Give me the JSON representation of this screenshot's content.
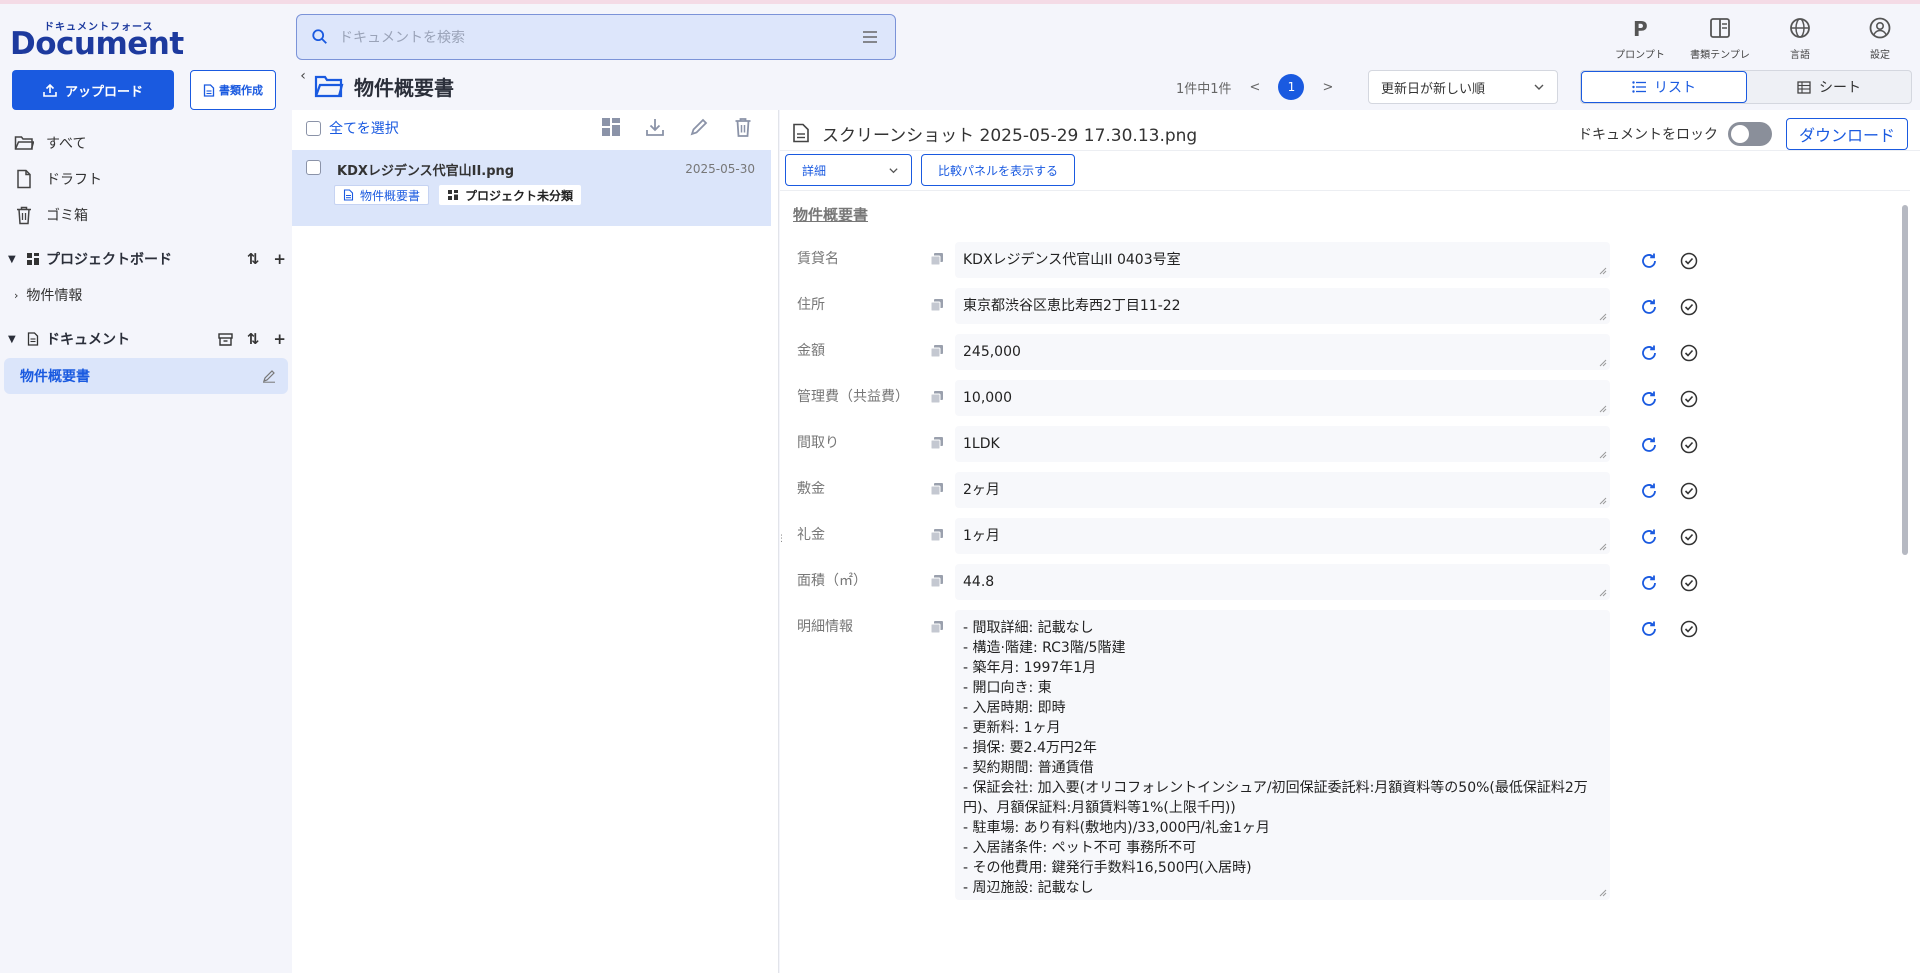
{
  "app": {
    "logo_kana": "ドキュメントフォース",
    "logo_name": "Document Force"
  },
  "search": {
    "placeholder": "ドキュメントを検索"
  },
  "top_icons": [
    {
      "label": "プロンプト",
      "icon": "prompt-p-icon"
    },
    {
      "label": "書類テンプレ",
      "icon": "template-icon"
    },
    {
      "label": "言語",
      "icon": "globe-icon"
    },
    {
      "label": "設定",
      "icon": "user-circle-icon"
    }
  ],
  "sidebar": {
    "upload_label": "アップロード",
    "create_label": "書類作成",
    "nav": [
      {
        "label": "すべて",
        "icon": "folder-open-icon"
      },
      {
        "label": "ドラフト",
        "icon": "file-icon"
      },
      {
        "label": "ゴミ箱",
        "icon": "trash-icon"
      }
    ],
    "project_board": {
      "label": "プロジェクトボード",
      "items": [
        "物件情報"
      ]
    },
    "documents": {
      "label": "ドキュメント",
      "active_item": "物件概要書"
    }
  },
  "list": {
    "folder_title": "物件概要書",
    "pager_text": "1件中1件",
    "current_page": "1",
    "sort_label": "更新日が新しい順",
    "view_list": "リスト",
    "view_sheet": "シート",
    "select_all": "全てを選択",
    "items": [
      {
        "filename": "KDXレジデンス代官山II.png",
        "date": "2025-05-30",
        "tag_type": "物件概要書",
        "tag_project": "プロジェクト未分類"
      }
    ]
  },
  "detail": {
    "filename": "スクリーンショット 2025-05-29 17.30.13.png",
    "lock_label": "ドキュメントをロック",
    "download_label": "ダウンロード",
    "mode_label": "詳細",
    "compare_label": "比較パネルを表示する",
    "section_title": "物件概要書",
    "fields": [
      {
        "label": "賃貸名",
        "value": "KDXレジデンス代官山II 0403号室"
      },
      {
        "label": "住所",
        "value": "東京都渋谷区恵比寿西2丁目11-22"
      },
      {
        "label": "金額",
        "value": "245,000"
      },
      {
        "label": "管理費（共益費）",
        "value": "10,000"
      },
      {
        "label": "間取り",
        "value": "1LDK"
      },
      {
        "label": "敷金",
        "value": "2ヶ月"
      },
      {
        "label": "礼金",
        "value": "1ヶ月"
      },
      {
        "label": "面積（㎡）",
        "value": "44.8"
      },
      {
        "label": "明細情報",
        "value": "- 間取詳細: 記載なし\n- 構造·階建: RC3階/5階建\n- 築年月: 1997年1月\n- 開口向き: 東\n- 入居時期: 即時\n- 更新料: 1ヶ月\n- 損保: 要2.4万円2年\n- 契約期間: 普通賃借\n- 保証会社: 加入要(オリコフォレントインシュア/初回保証委託料:月額資料等の50%(最低保証料2万円)、月額保証料:月額賃料等1%(上限千円))\n- 駐車場: あり有料(敷地内)/33,000円/礼金1ヶ月\n- 入居諸条件: ペット不可 事務所不可\n- その他費用: 鍵発行手数料16,500円(入居時)\n- 周辺施設: 記載なし"
      }
    ]
  }
}
